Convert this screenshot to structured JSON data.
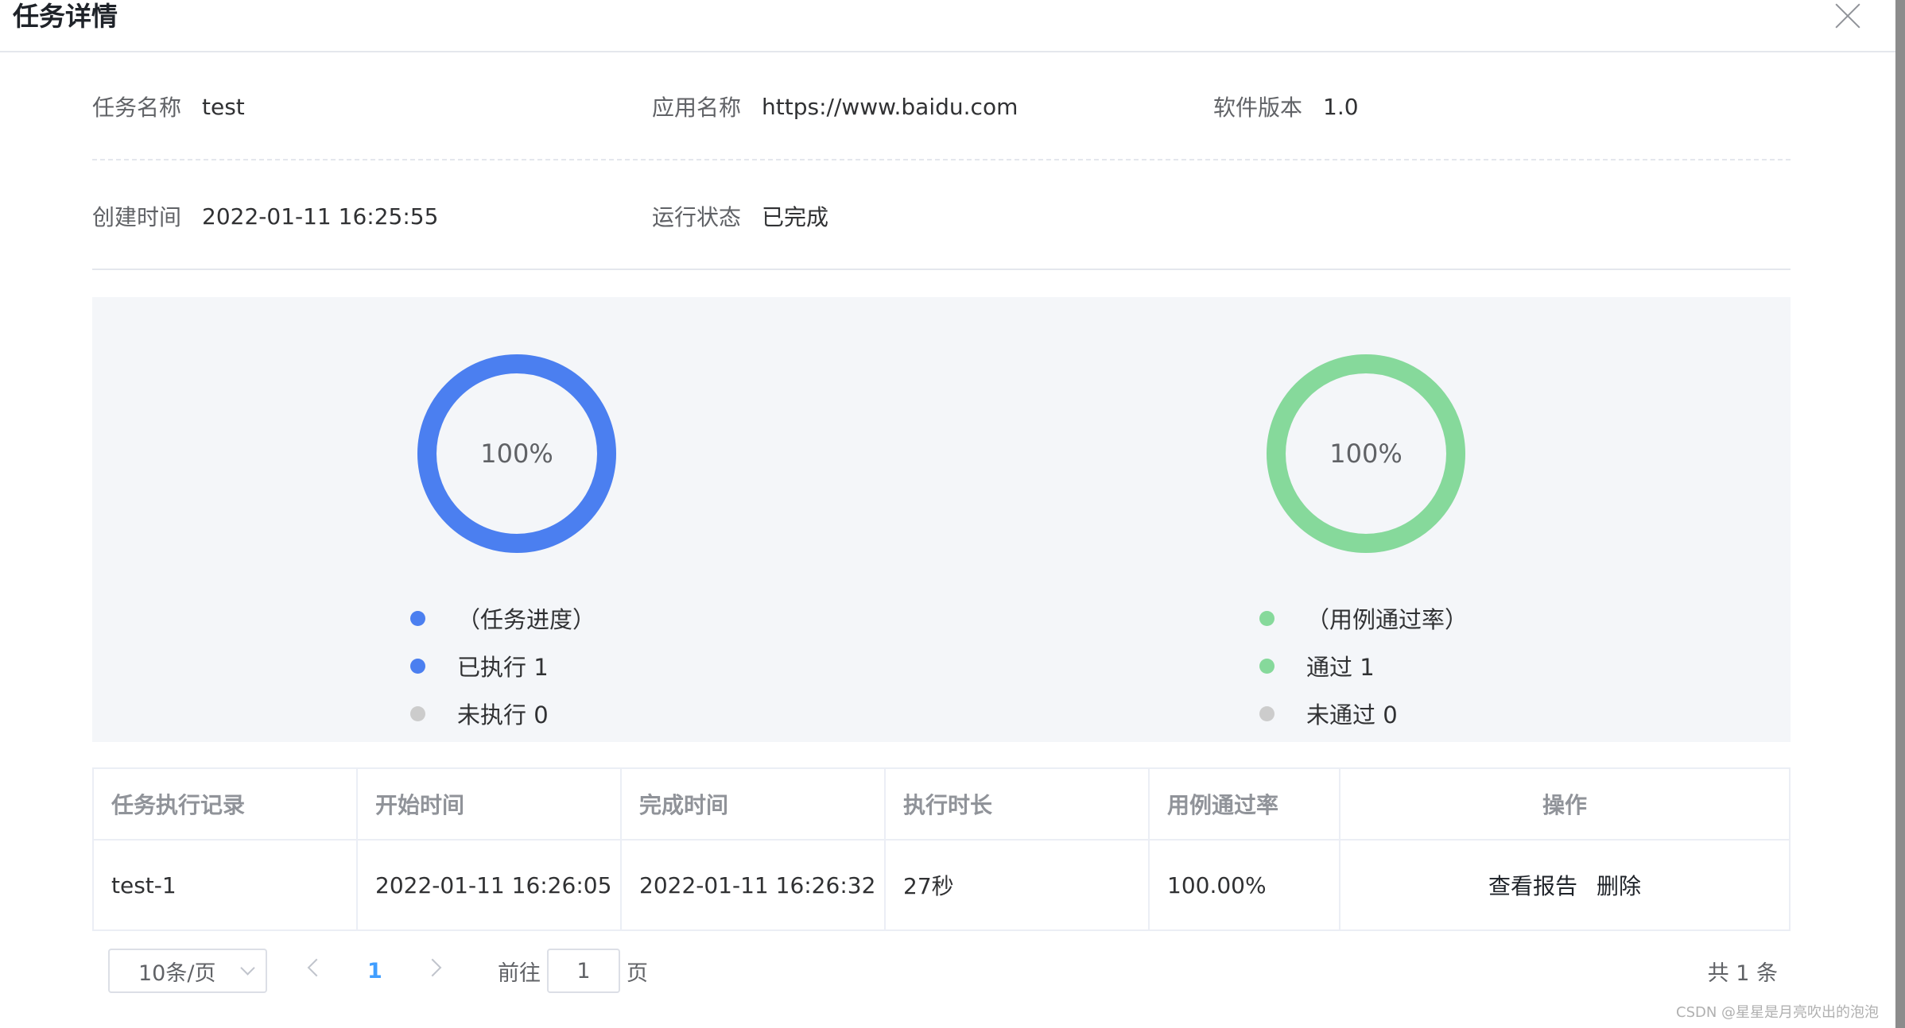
{
  "dialog": {
    "title": "任务详情"
  },
  "info": {
    "task_name_label": "任务名称",
    "task_name": "test",
    "app_name_label": "应用名称",
    "app_name": "https://www.baidu.com",
    "version_label": "软件版本",
    "version": "1.0",
    "created_label": "创建时间",
    "created": "2022-01-11 16:25:55",
    "status_label": "运行状态",
    "status": "已完成"
  },
  "progress": {
    "percent_text": "100%",
    "percent": 100,
    "color": "#4b7ff0",
    "legend": [
      {
        "label": "（任务进度）",
        "color": "#4b7ff0"
      },
      {
        "label": "已执行 1",
        "color": "#4b7ff0"
      },
      {
        "label": "未执行 0",
        "color": "#cccccc"
      }
    ]
  },
  "pass_rate": {
    "percent_text": "100%",
    "percent": 100,
    "color": "#86d99b",
    "legend": [
      {
        "label": "（用例通过率）",
        "color": "#86d99b"
      },
      {
        "label": "通过 1",
        "color": "#86d99b"
      },
      {
        "label": "未通过 0",
        "color": "#cccccc"
      }
    ]
  },
  "table": {
    "columns": [
      "任务执行记录",
      "开始时间",
      "完成时间",
      "执行时长",
      "用例通过率",
      "操作"
    ],
    "rows": [
      {
        "record": "test-1",
        "start": "2022-01-11 16:26:05",
        "end": "2022-01-11 16:26:32",
        "duration": "27秒",
        "rate": "100.00%",
        "view_report": "查看报告",
        "delete": "删除"
      }
    ]
  },
  "pagination": {
    "page_size": "10条/页",
    "current_page": "1",
    "goto_label": "前往",
    "goto_value": "1",
    "goto_suffix": "页",
    "total": "共 1 条"
  },
  "watermark": "CSDN @星星是月亮吹出的泡泡"
}
